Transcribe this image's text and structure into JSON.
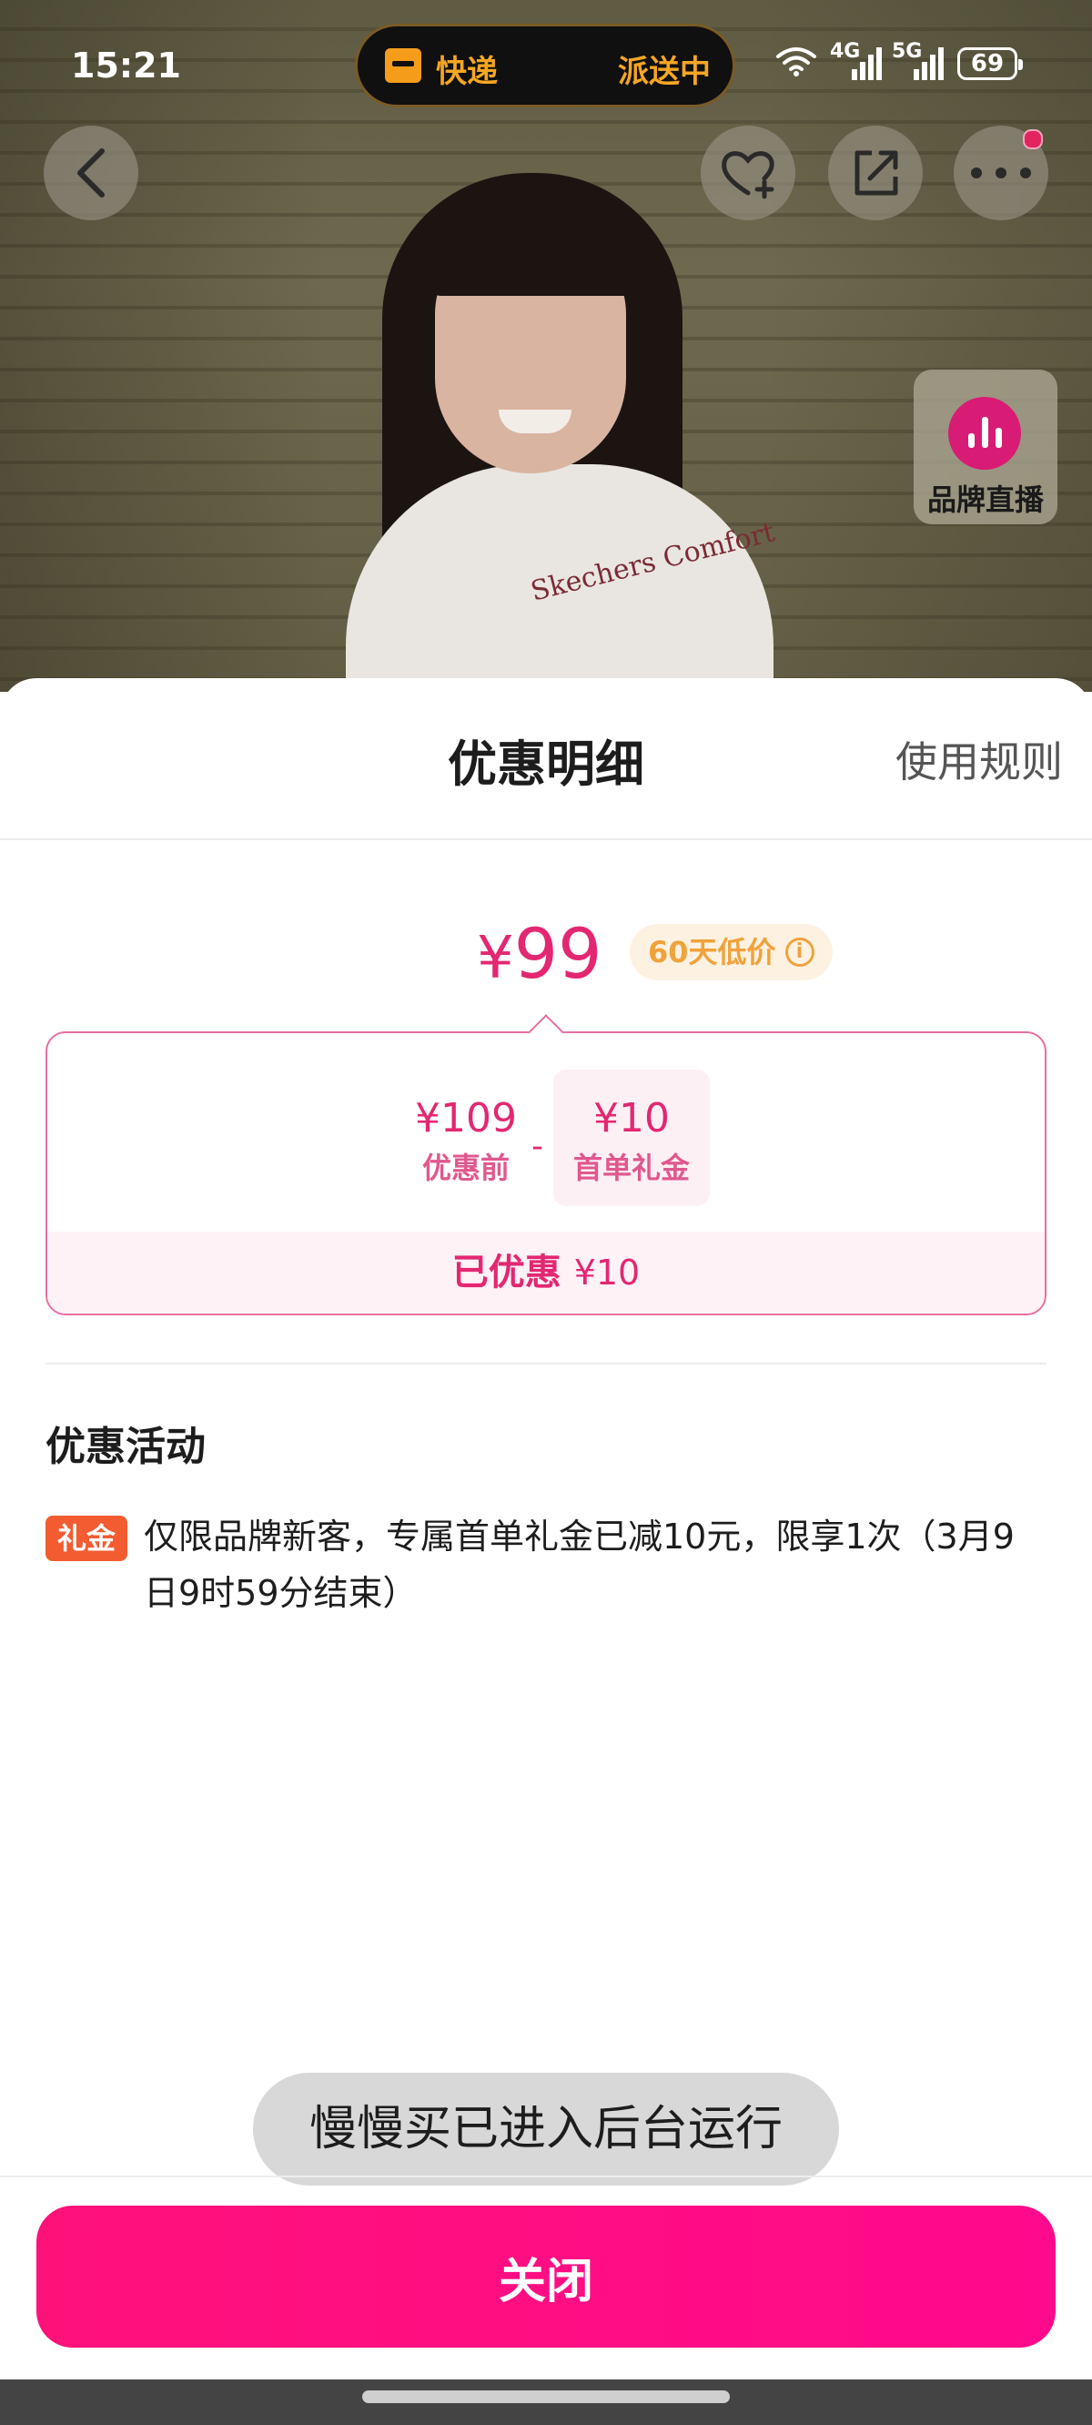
{
  "status_bar": {
    "time": "15:21",
    "island_left": "快递",
    "island_right": "派送中",
    "signal_1": "4G",
    "signal_2": "5G",
    "battery": "69"
  },
  "overlay": {
    "brand_live_label": "品牌直播",
    "hoodie_print": "Skechers Comfort"
  },
  "sheet": {
    "title": "优惠明细",
    "rules_link": "使用规则",
    "final_price_symbol": "¥",
    "final_price": "99",
    "low_price_badge": "60天低价",
    "calc": {
      "before_value": "¥109",
      "before_label": "优惠前",
      "minus": "-",
      "gift_value": "¥10",
      "gift_label": "首单礼金",
      "saved_label": "已优惠",
      "saved_amount": "¥10"
    },
    "section_title": "优惠活动",
    "promo_tag": "礼金",
    "promo_text": "仅限品牌新客，专属首单礼金已减10元，限享1次（3月9日9时59分结束）",
    "toast": "慢慢买已进入后台运行",
    "close_button": "关闭"
  },
  "colors": {
    "accent_pink": "#e32771",
    "button_pink": "#ff117a",
    "badge_orange": "#f0a23c",
    "tag_orange": "#f25c30"
  }
}
